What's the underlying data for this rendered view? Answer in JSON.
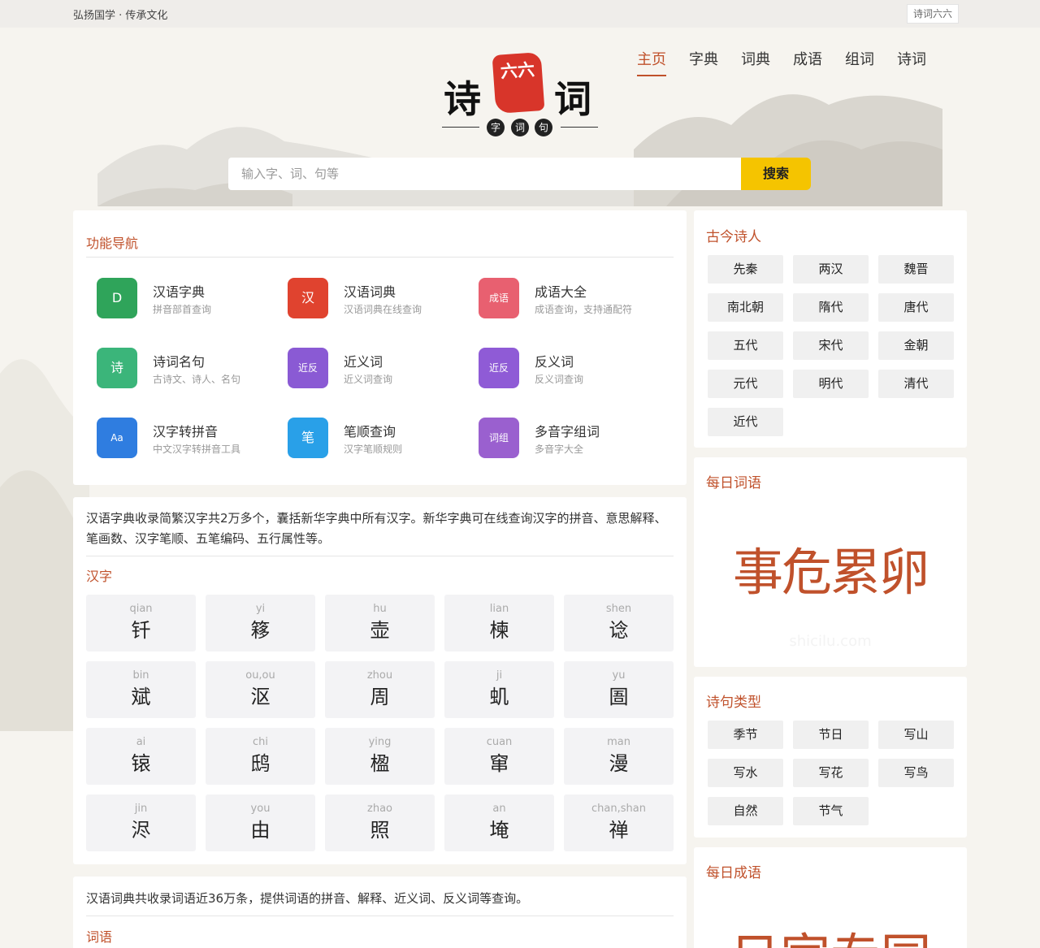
{
  "topbar": {
    "slogan": "弘扬国学 · 传承文化",
    "site_button": "诗词六六"
  },
  "nav": {
    "items": [
      "主页",
      "字典",
      "词典",
      "成语",
      "组词",
      "诗词"
    ],
    "active": 0
  },
  "logo": {
    "left": "诗",
    "seal": "六六",
    "right": "词",
    "sub": [
      "字",
      "词",
      "句"
    ]
  },
  "search": {
    "placeholder": "输入字、词、句等",
    "button": "搜索"
  },
  "func": {
    "title": "功能导航",
    "items": [
      {
        "name": "汉语字典",
        "desc": "拼音部首查询",
        "icon": "D",
        "color": "#2fa45a",
        "icon_name": "dictionary-icon"
      },
      {
        "name": "汉语词典",
        "desc": "汉语词典在线查询",
        "icon": "汉",
        "color": "#e0432f",
        "icon_name": "han-book-icon"
      },
      {
        "name": "成语大全",
        "desc": "成语查询，支持通配符",
        "icon": "成语",
        "color": "#e86070",
        "icon_name": "idiom-book-icon"
      },
      {
        "name": "诗词名句",
        "desc": "古诗文、诗人、名句",
        "icon": "诗",
        "color": "#3bb57a",
        "icon_name": "poem-book-icon"
      },
      {
        "name": "近义词",
        "desc": "近义词查询",
        "icon": "近反",
        "color": "#8a5ad4",
        "icon_name": "synonym-book-icon"
      },
      {
        "name": "反义词",
        "desc": "反义词查询",
        "icon": "近反",
        "color": "#8f5bd6",
        "icon_name": "antonym-book-icon"
      },
      {
        "name": "汉字转拼音",
        "desc": "中文汉字转拼音工具",
        "icon": "Aa",
        "color": "#2f7de0",
        "icon_name": "pinyin-icon"
      },
      {
        "name": "笔顺查询",
        "desc": "汉字笔顺规则",
        "icon": "笔",
        "color": "#29a0e8",
        "icon_name": "stroke-order-icon"
      },
      {
        "name": "多音字组词",
        "desc": "多音字大全",
        "icon": "词组",
        "color": "#9a60cf",
        "icon_name": "word-group-icon"
      }
    ]
  },
  "zidian": {
    "intro": "汉语字典收录简繁汉字共2万多个，囊括新华字典中所有汉字。新华字典可在线查询汉字的拼音、意思解释、笔画数、汉字笔顺、五笔编码、五行属性等。",
    "label": "汉字",
    "chars": [
      {
        "py": "qian",
        "ch": "钎"
      },
      {
        "py": "yi",
        "ch": "簃"
      },
      {
        "py": "hu",
        "ch": "壶"
      },
      {
        "py": "lian",
        "ch": "楝"
      },
      {
        "py": "shen",
        "ch": "谂"
      },
      {
        "py": "bin",
        "ch": "斌"
      },
      {
        "py": "ou,ou",
        "ch": "沤"
      },
      {
        "py": "zhou",
        "ch": "周"
      },
      {
        "py": "ji",
        "ch": "虮"
      },
      {
        "py": "yu",
        "ch": "圄"
      },
      {
        "py": "ai",
        "ch": "锿"
      },
      {
        "py": "chi",
        "ch": "鸱"
      },
      {
        "py": "ying",
        "ch": "楹"
      },
      {
        "py": "cuan",
        "ch": "窜"
      },
      {
        "py": "man",
        "ch": "漫"
      },
      {
        "py": "jin",
        "ch": "浕"
      },
      {
        "py": "you",
        "ch": "由"
      },
      {
        "py": "zhao",
        "ch": "照"
      },
      {
        "py": "an",
        "ch": "埯"
      },
      {
        "py": "chan,shan",
        "ch": "禅"
      }
    ]
  },
  "cidian": {
    "intro": "汉语词典共收录词语近36万条，提供词语的拼音、解释、近义词、反义词等查询。",
    "label": "词语"
  },
  "poets": {
    "title": "古今诗人",
    "items": [
      "先秦",
      "两汉",
      "魏晋",
      "南北朝",
      "隋代",
      "唐代",
      "五代",
      "宋代",
      "金朝",
      "元代",
      "明代",
      "清代",
      "近代"
    ]
  },
  "daily_word": {
    "title": "每日词语",
    "word": "事危累卵",
    "watermark": "shicilu.com"
  },
  "poem_types": {
    "title": "诗句类型",
    "items": [
      "季节",
      "节日",
      "写山",
      "写水",
      "写花",
      "写鸟",
      "自然",
      "节气"
    ]
  },
  "daily_idiom": {
    "title": "每日成语",
    "word": "日家专园"
  }
}
